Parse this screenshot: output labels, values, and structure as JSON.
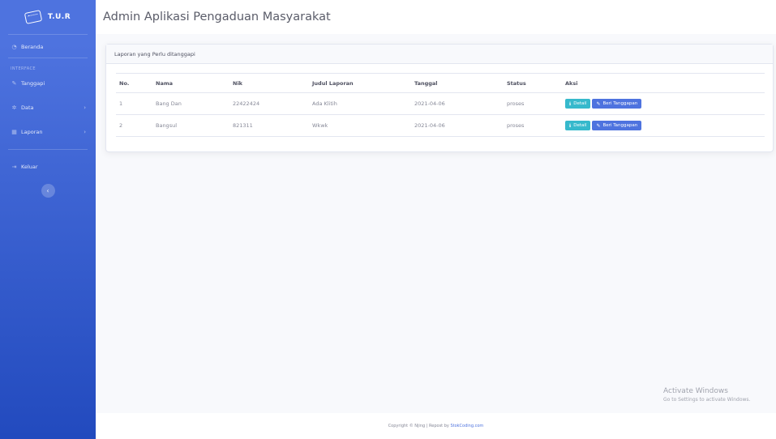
{
  "sidebar": {
    "brand": "T.U.R",
    "brand_icon": "keyboard-icon",
    "items": [
      {
        "label": "Beranda",
        "icon": "tachometer-icon"
      },
      {
        "label": "Tanggapi",
        "icon": "edit-icon"
      },
      {
        "label": "Data",
        "icon": "gear-icon"
      },
      {
        "label": "Laporan",
        "icon": "table-icon"
      },
      {
        "label": "Keluar",
        "icon": "logout-icon"
      }
    ],
    "heading": "INTERFACE",
    "toggle_icon": "chevron-left-icon"
  },
  "header": {
    "title": "Admin Aplikasi Pengaduan Masyarakat"
  },
  "card": {
    "title": "Laporan yang Perlu ditanggapi",
    "columns": [
      "No.",
      "Nama",
      "Nik",
      "Judul Laporan",
      "Tanggal",
      "Status",
      "Aksi"
    ],
    "rows": [
      {
        "no": "1",
        "nama": "Bang Dan",
        "nik": "22422424",
        "judul": "Ada Klitih",
        "tanggal": "2021-04-06",
        "status": "proses"
      },
      {
        "no": "2",
        "nama": "Bangsul",
        "nik": "821311",
        "judul": "Wkwk",
        "tanggal": "2021-04-06",
        "status": "proses"
      }
    ],
    "buttons": {
      "detail": "Detail",
      "respond": "Beri Tanggapan"
    }
  },
  "watermark": {
    "title": "Activate Windows",
    "subtitle": "Go to Settings to activate Windows."
  },
  "footer": {
    "text": "Copyright © Njing | Repost by ",
    "link": "StokCoding.com"
  },
  "colors": {
    "sidebar": "#4e73df",
    "info": "#36b9cc",
    "primary": "#4e73df"
  }
}
